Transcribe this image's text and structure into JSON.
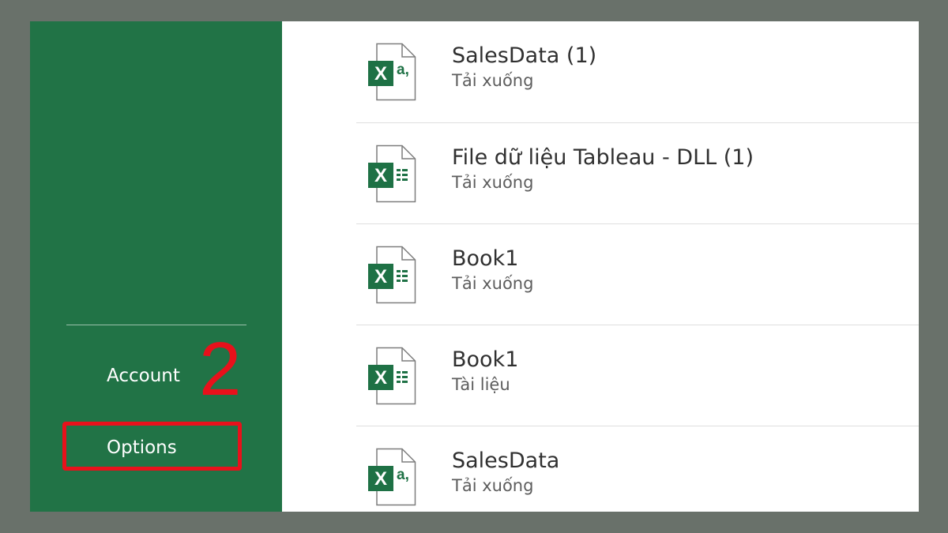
{
  "sidebar": {
    "account_label": "Account",
    "options_label": "Options",
    "accent_color": "#217346"
  },
  "annotation": {
    "step_number": "2",
    "highlight_color": "#e8111b"
  },
  "recent_files": [
    {
      "name": "SalesData (1)",
      "location": "Tải xuống",
      "icon": "excel-csv-icon"
    },
    {
      "name": "File dữ liệu Tableau - DLL (1)",
      "location": "Tải xuống",
      "icon": "excel-workbook-icon"
    },
    {
      "name": "Book1",
      "location": "Tải xuống",
      "icon": "excel-workbook-icon"
    },
    {
      "name": "Book1",
      "location": "Tài liệu",
      "icon": "excel-workbook-icon"
    },
    {
      "name": "SalesData",
      "location": "Tải xuống",
      "icon": "excel-csv-icon"
    }
  ]
}
